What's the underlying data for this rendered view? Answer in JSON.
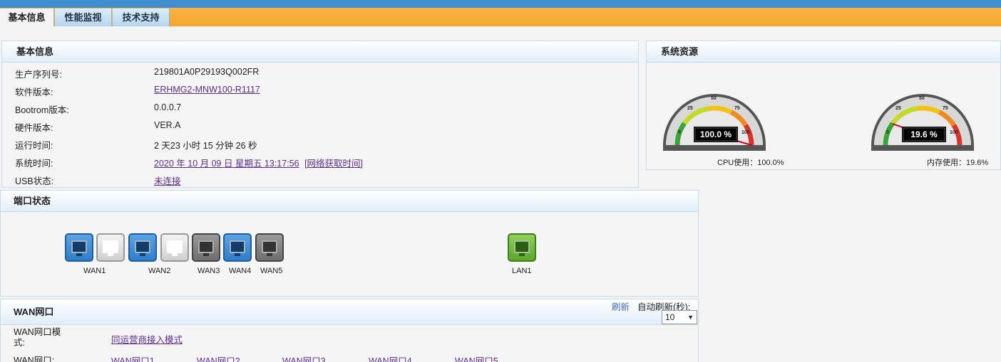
{
  "tabs": [
    {
      "label": "基本信息"
    },
    {
      "label": "性能监视"
    },
    {
      "label": "技术支持"
    }
  ],
  "basic_info": {
    "title": "基本信息",
    "rows": [
      {
        "label": "生产序列号:",
        "value": "219801A0P29193Q002FR"
      },
      {
        "label": "软件版本:",
        "value": "ERHMG2-MNW100-R1117"
      },
      {
        "label": "Bootrom版本:",
        "value": "0.0.0.7"
      },
      {
        "label": "硬件版本:",
        "value": "VER.A"
      },
      {
        "label": "运行时间:",
        "value": "2 天23 小时 15 分钟 26 秒"
      },
      {
        "label": "系统时间:",
        "value": "2020 年 10 月 09 日 星期五 13:17:56",
        "extra": "[网络获取时间]"
      },
      {
        "label": "USB状态:",
        "value": "未连接"
      }
    ]
  },
  "resources": {
    "title": "系统资源",
    "gauges": [
      {
        "name": "cpu",
        "percent": 100.0,
        "display": "100.0 %",
        "caption": "CPU使用：100.0%"
      },
      {
        "name": "memory",
        "percent": 19.6,
        "display": "19.6 %",
        "caption": "内存使用：19.6%"
      }
    ],
    "ticks": [
      "0",
      "25",
      "50",
      "75",
      "100"
    ]
  },
  "ports": {
    "title": "端口状态",
    "items": [
      {
        "label": "WAN1",
        "state": "active"
      },
      {
        "label": "",
        "state": "empty"
      },
      {
        "label": "WAN2",
        "state": "active"
      },
      {
        "label": "",
        "state": "empty"
      },
      {
        "label": "WAN3",
        "state": "inactive"
      },
      {
        "label": "WAN4",
        "state": "active"
      },
      {
        "label": "WAN5",
        "state": "inactive"
      },
      {
        "label": "LAN1",
        "state": "lan"
      }
    ]
  },
  "wan": {
    "title": "WAN网口",
    "refresh_label": "刷新",
    "auto_refresh_label": "自动刷新(秒):",
    "auto_refresh_value": "10",
    "mode_label": "WAN网口模式:",
    "mode_label_line1": "WAN网口模",
    "mode_label_line2": "式:",
    "mode_value": "同运营商接入模式",
    "ports_label": "WAN网口:",
    "port_links": [
      "WAN网口1",
      "WAN网口2",
      "WAN网口3",
      "WAN网口4",
      "WAN网口5"
    ]
  },
  "colors": {
    "accent_blue": "#3f8ed0",
    "tab_orange": "#f5a62e",
    "link_purple": "#5a2d8c",
    "port_blue": "#2f7fc9",
    "port_green": "#5aa82a",
    "port_gray": "#6e6e6e"
  }
}
